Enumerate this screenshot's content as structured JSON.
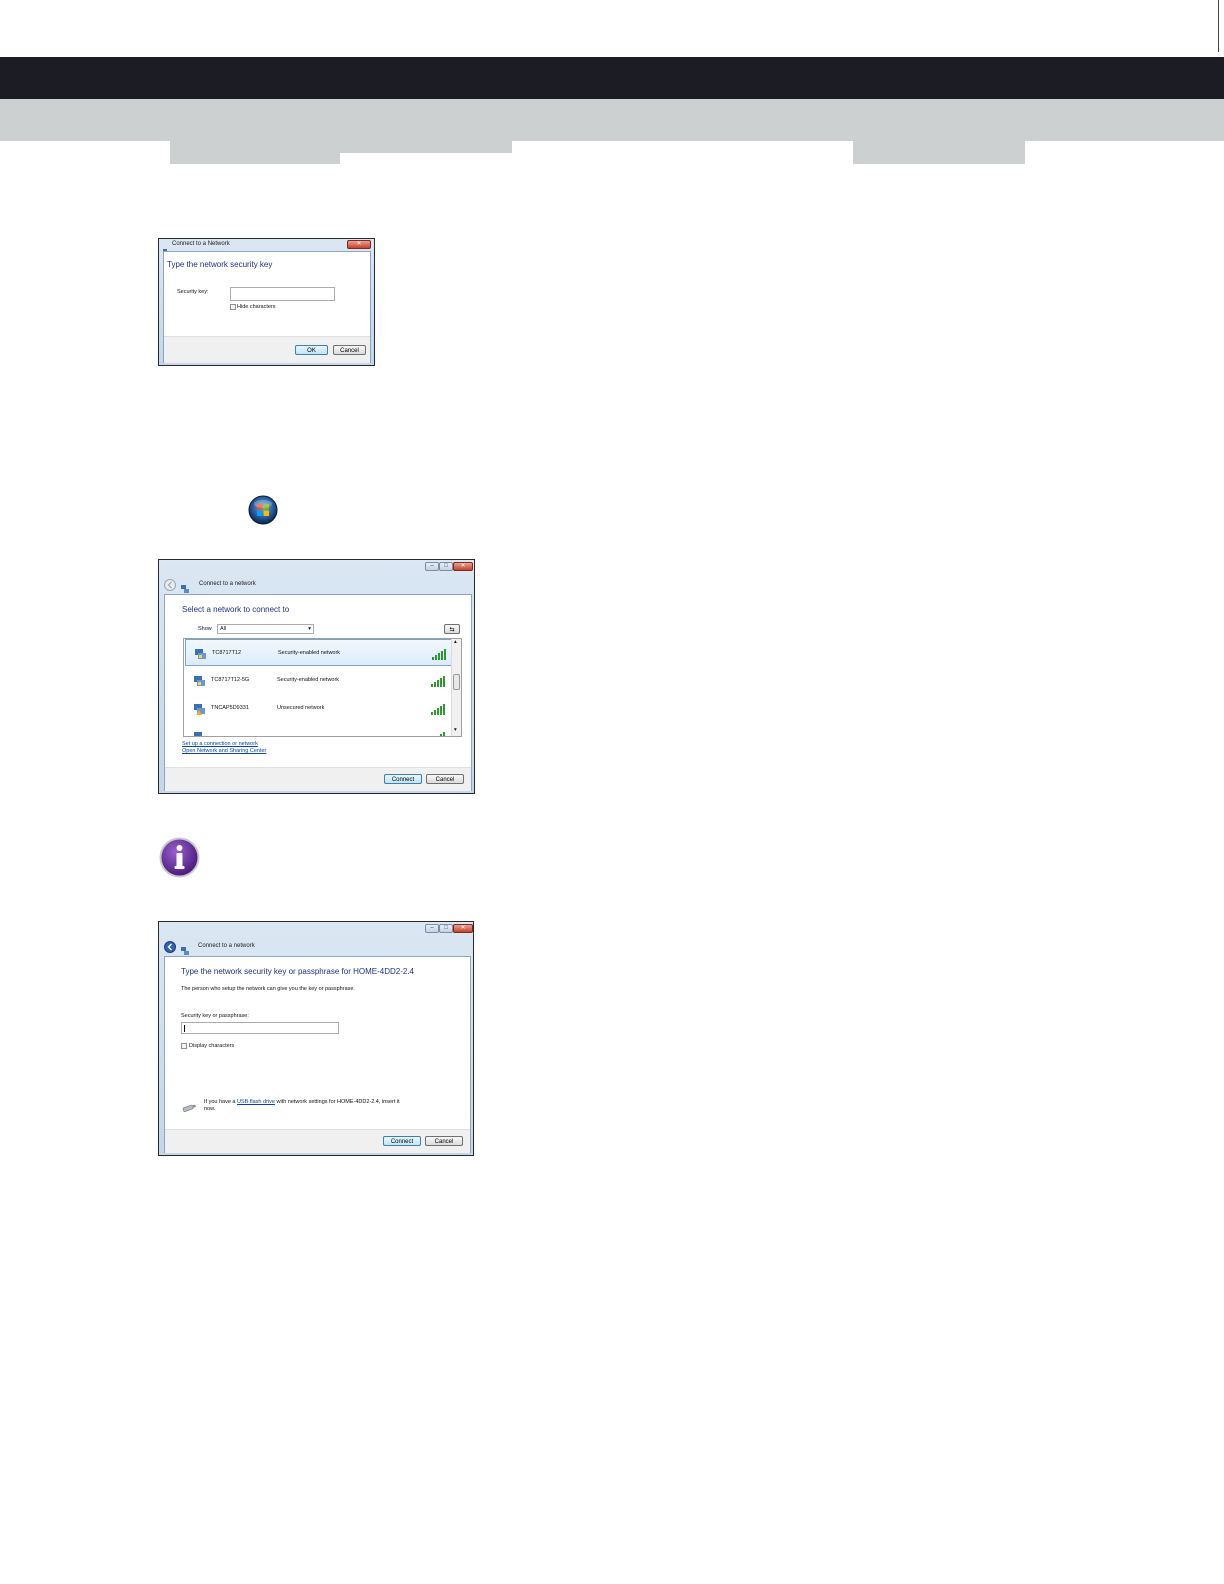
{
  "dialog1": {
    "title": "Connect to a Network",
    "heading": "Type the network security key",
    "security_key_label": "Security key:",
    "hide_characters_label": "Hide characters",
    "ok_label": "OK",
    "cancel_label": "Cancel"
  },
  "dialog2": {
    "title": "Connect to a network",
    "heading": "Select a network to connect to",
    "show_label": "Show",
    "show_value": "All",
    "networks": [
      {
        "name": "TC8717T12",
        "status": "Security-enabled network"
      },
      {
        "name": "TC8717T12-5G",
        "status": "Security-enabled network"
      },
      {
        "name": "TNCAP5D9331",
        "status": "Unsecured network"
      }
    ],
    "link_setup": "Set up a connection or network",
    "link_sharing": "Open Network and Sharing Center",
    "connect_label": "Connect",
    "cancel_label": "Cancel"
  },
  "dialog3": {
    "title": "Connect to a network",
    "heading": "Type the network security key or passphrase for HOME-4DD2-2.4",
    "description": "The person who setup the network can give you the key or passphrase.",
    "field_label": "Security key or passphrase:",
    "display_characters_label": "Display characters",
    "usb_prefix": "If you have a",
    "usb_link": "USB flash drive",
    "usb_suffix": "with network settings for HOME-4DD2-2.4, insert it",
    "usb_suffix2": "now.",
    "connect_label": "Connect",
    "cancel_label": "Cancel"
  },
  "colors": {
    "header": "#1c1c24",
    "subheader": "#ccd0d1",
    "info_icon": "#6b2fa0"
  },
  "icons": [
    "windows-start-orb-icon",
    "info-icon",
    "network-icon",
    "signal-bars-icon",
    "usb-drive-icon",
    "back-arrow-icon"
  ]
}
